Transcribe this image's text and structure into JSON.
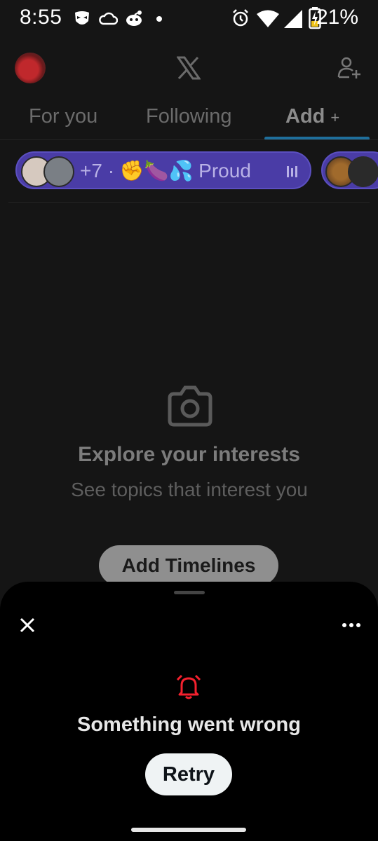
{
  "status_bar": {
    "time": "8:55",
    "battery_percent": "21%",
    "icons": [
      "grindr-icon",
      "cloud-icon",
      "reddit-icon",
      "dot-icon",
      "alarm-icon",
      "wifi-icon",
      "signal-icon",
      "battery-charging-icon"
    ]
  },
  "header": {
    "logo": "X",
    "icons": [
      "avatar",
      "x-logo-icon",
      "follow-person-icon"
    ]
  },
  "tabs": [
    {
      "label": "For you",
      "active": false
    },
    {
      "label": "Following",
      "active": false
    },
    {
      "label": "Add",
      "suffix": "+",
      "active": true
    }
  ],
  "spaces": {
    "first": {
      "text": "+7 · ✊🍆💦 Proud",
      "color": "#4a3ca6"
    }
  },
  "empty_state": {
    "title": "Explore your interests",
    "subtitle": "See topics that interest you",
    "button": "Add Timelines"
  },
  "sheet": {
    "error_title": "Something went wrong",
    "retry_label": "Retry",
    "bell_color": "#f4212e"
  }
}
